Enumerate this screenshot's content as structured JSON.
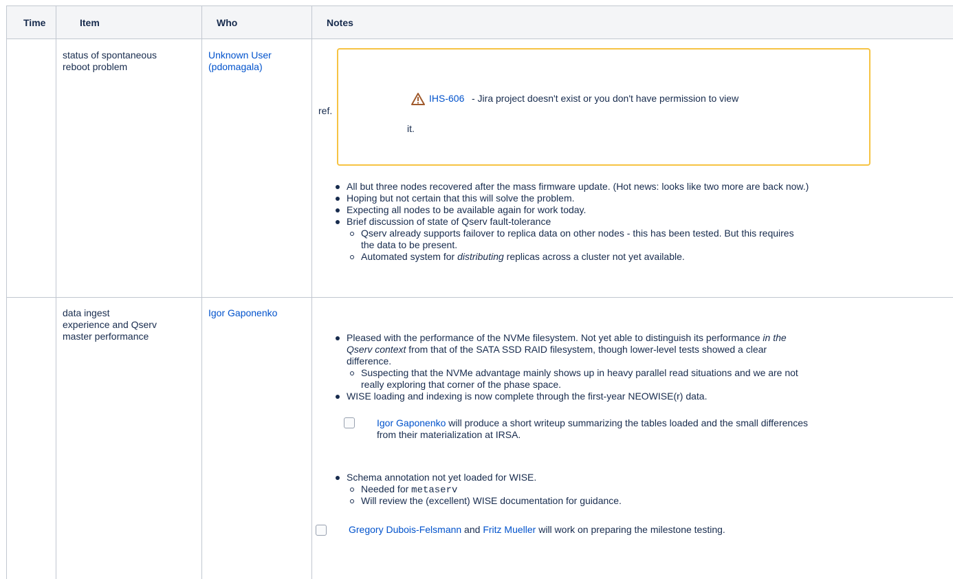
{
  "table": {
    "headers": {
      "time": "Time",
      "item": "Item",
      "who": "Who",
      "notes": "Notes"
    },
    "row1": {
      "item_line1": "status of spontaneous",
      "item_line2": "reboot problem",
      "who_line1": "Unknown User",
      "who_line2": "(pdomagala)",
      "ref_label": "ref.",
      "jira_key": "IHS-606",
      "jira_msg_line1": " - Jira project doesn't exist or you don't have permission to view",
      "jira_msg_line2": "it.",
      "bullets": [
        "All but three nodes recovered after the mass firmware update. (Hot news: looks like two more are back now.)",
        "Hoping but not certain that this will solve the problem.",
        "Expecting all nodes to be available again for work today.",
        "Brief discussion of state of Qserv fault-tolerance"
      ],
      "sub1_line1": "Qserv already supports failover to replica data on other nodes - this has been tested. But this requires",
      "sub1_line2": "the data to be present.",
      "sub2_pre": "Automated system for ",
      "sub2_em": "distributing",
      "sub2_post": " replicas across a cluster not yet available."
    },
    "row2": {
      "item_line1": "data ingest",
      "item_line2": "experience and Qserv",
      "item_line3": "master performance",
      "who": "Igor Gaponenko",
      "b1_line1_pre": "Pleased with the performance of the NVMe filesystem. Not yet able to distinguish its performance ",
      "b1_line1_em": "in the",
      "b1_line2_em": "Qserv context",
      "b1_line2_post": " from that of the SATA SSD RAID filesystem, though lower-level tests showed a clear",
      "b1_line3": "difference.",
      "b1_sub_line1": "Suspecting that the NVMe advantage mainly shows up in heavy parallel read situations and we are not",
      "b1_sub_line2": "really exploring that corner of the phase space.",
      "b2": "WISE loading and indexing is now complete through the first-year NEOWISE(r) data.",
      "task1_user": "Igor Gaponenko",
      "task1_line1": " will produce a short writeup summarizing the tables loaded and the small differences",
      "task1_line2": "from their materialization at IRSA.",
      "b3": "Schema annotation not yet loaded for WISE.",
      "b3_sub1_pre": "Needed for ",
      "b3_sub1_code": "metaserv",
      "b3_sub2": "Will review the (excellent) WISE documentation for guidance.",
      "task2_user1": "Gregory Dubois-Felsmann",
      "task2_and": " and ",
      "task2_user2": "Fritz Mueller",
      "task2_post": " will work on preparing the milestone testing."
    }
  }
}
